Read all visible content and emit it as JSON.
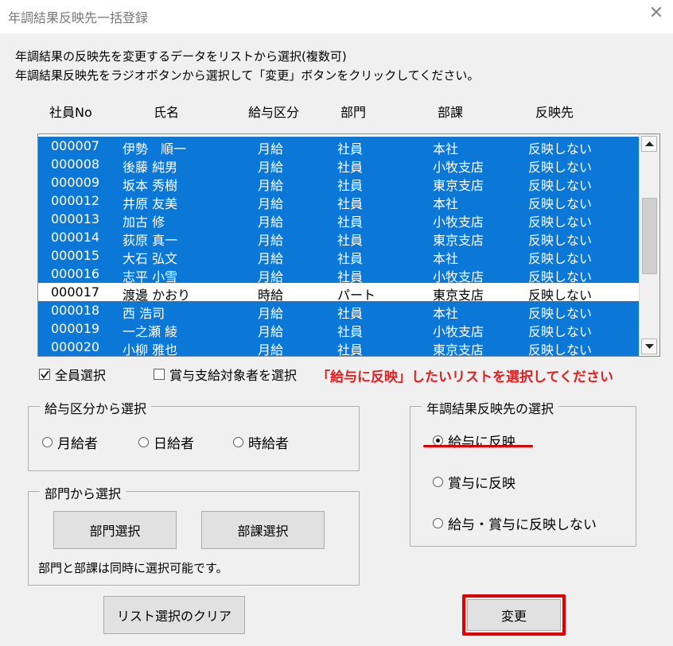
{
  "window": {
    "title": "年調結果反映先一括登録"
  },
  "instructions": {
    "line1": "年調結果の反映先を変更するデータをリストから選択(複数可)",
    "line2": "年調結果反映先をラジオボタンから選択して「変更」ボタンをクリックしてください。"
  },
  "list": {
    "headers": [
      "社員No",
      "氏名",
      "給与区分",
      "部門",
      "部課",
      "反映先"
    ],
    "rows": [
      {
        "no": "000007",
        "name": "伊勢　順一",
        "kubun": "月給",
        "bumon": "社員",
        "buka": "本社",
        "target": "反映しない",
        "selected": true
      },
      {
        "no": "000008",
        "name": "後藤 純男",
        "kubun": "月給",
        "bumon": "社員",
        "buka": "小牧支店",
        "target": "反映しない",
        "selected": true
      },
      {
        "no": "000009",
        "name": "坂本 秀樹",
        "kubun": "月給",
        "bumon": "社員",
        "buka": "東京支店",
        "target": "反映しない",
        "selected": true
      },
      {
        "no": "000012",
        "name": "井原 友美",
        "kubun": "月給",
        "bumon": "社員",
        "buka": "本社",
        "target": "反映しない",
        "selected": true
      },
      {
        "no": "000013",
        "name": "加古 修",
        "kubun": "月給",
        "bumon": "社員",
        "buka": "小牧支店",
        "target": "反映しない",
        "selected": true
      },
      {
        "no": "000014",
        "name": "荻原 真一",
        "kubun": "月給",
        "bumon": "社員",
        "buka": "東京支店",
        "target": "反映しない",
        "selected": true
      },
      {
        "no": "000015",
        "name": "大石 弘文",
        "kubun": "月給",
        "bumon": "社員",
        "buka": "本社",
        "target": "反映しない",
        "selected": true
      },
      {
        "no": "000016",
        "name": "志平 小雪",
        "kubun": "月給",
        "bumon": "社員",
        "buka": "小牧支店",
        "target": "反映しない",
        "selected": true
      },
      {
        "no": "000017",
        "name": "渡邊 かおり",
        "kubun": "時給",
        "bumon": "パート",
        "buka": "東京支店",
        "target": "反映しない",
        "selected": false
      },
      {
        "no": "000018",
        "name": "西 浩司",
        "kubun": "月給",
        "bumon": "社員",
        "buka": "本社",
        "target": "反映しない",
        "selected": true
      },
      {
        "no": "000019",
        "name": "一之瀬 綾",
        "kubun": "月給",
        "bumon": "社員",
        "buka": "小牧支店",
        "target": "反映しない",
        "selected": true
      },
      {
        "no": "000020",
        "name": "小柳 雅也",
        "kubun": "月給",
        "bumon": "社員",
        "buka": "東京支店",
        "target": "反映しない",
        "selected": true
      }
    ]
  },
  "checkboxes": {
    "select_all": {
      "label": "全員選択",
      "checked": true
    },
    "bonus_targets": {
      "label": "賞与支給対象者を選択",
      "checked": false
    }
  },
  "annotation": "「給与に反映」したいリストを選択してください",
  "group_kubun": {
    "legend": "給与区分から選択",
    "options": [
      "月給者",
      "日給者",
      "時給者"
    ]
  },
  "group_bumon": {
    "legend": "部門から選択",
    "bumon_button": "部門選択",
    "buka_button": "部課選択",
    "note": "部門と部課は同時に選択可能です。"
  },
  "group_target": {
    "legend": "年調結果反映先の選択",
    "options": [
      "給与に反映",
      "賞与に反映",
      "給与・賞与に反映しない"
    ],
    "selected_index": 0
  },
  "buttons": {
    "clear": "リスト選択のクリア",
    "change": "変更"
  },
  "colors": {
    "selection": "#0b78d7",
    "annotation": "#e02020",
    "highlight": "#e00000"
  }
}
